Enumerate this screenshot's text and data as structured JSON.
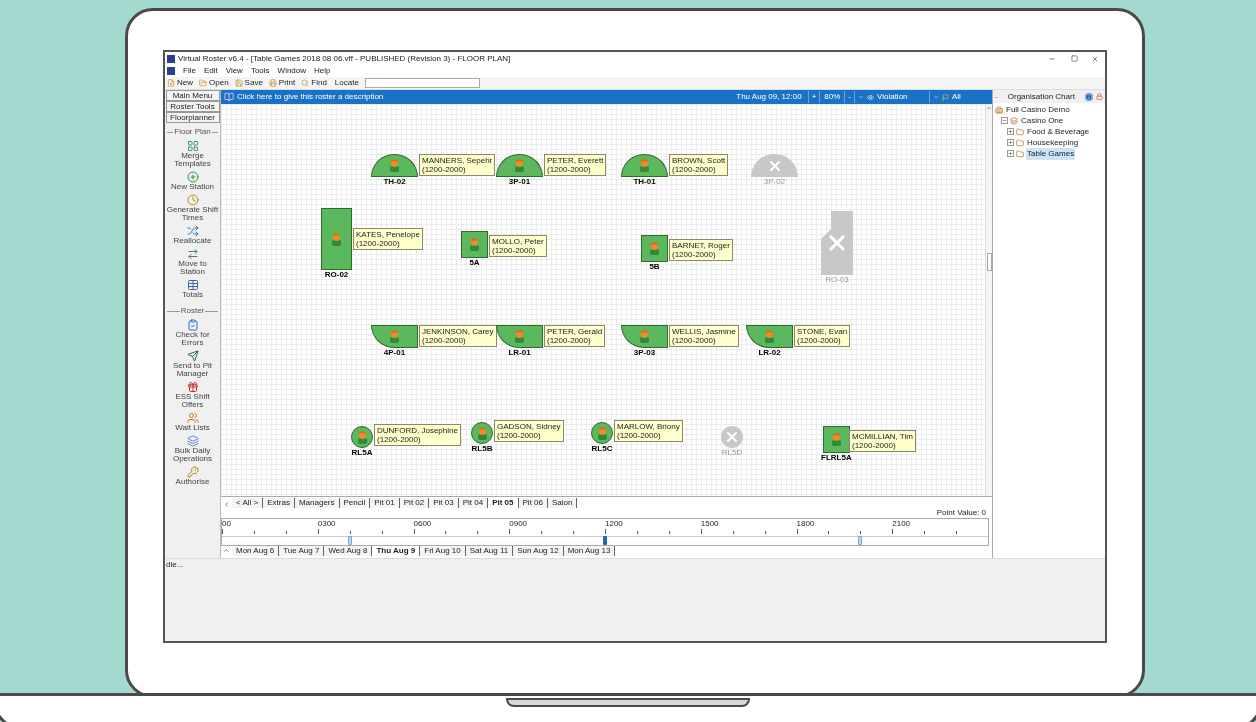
{
  "window": {
    "title": "Virtual Roster v6.4 - [Table Games 2018 08 06.vff - PUBLISHED (Revision 3) - FLOOR PLAN]"
  },
  "menu": [
    "File",
    "Edit",
    "View",
    "Tools",
    "Window",
    "Help"
  ],
  "toolbar": {
    "buttons": [
      "New",
      "Open",
      "Save",
      "Print",
      "Find"
    ],
    "locate_label": "Locate"
  },
  "sidebar": {
    "buttons": [
      "Main Menu",
      "Roster Tools",
      "Floorplanner"
    ],
    "sections": [
      {
        "title": "Floor Plan",
        "items": [
          "Merge Templates",
          "New Station",
          "Generate Shift Times",
          "Reallocate",
          "Move to Station",
          "Totals"
        ]
      },
      {
        "title": "Roster",
        "items": [
          "Check for Errors",
          "Send to Pit Manager",
          "ESS Shift Offers",
          "Wait Lists",
          "Bulk Daily Operations",
          "Authorise"
        ]
      }
    ]
  },
  "header_bar": {
    "description": "Click here to give this roster a description",
    "datetime": "Thu Aug 09, 12:00",
    "zoom_in": "+",
    "zoom": "80%",
    "zoom_out": "-",
    "filter": "Violation",
    "scope": "All"
  },
  "stations": [
    {
      "label": "TH-02",
      "kind": "dome",
      "active": true,
      "staff": {
        "name": "MANNERS, Sepehr",
        "hours": "(1200-2000)"
      }
    },
    {
      "label": "3P-01",
      "kind": "dome",
      "active": true,
      "staff": {
        "name": "PETER, Everett",
        "hours": "(1200-2000)"
      }
    },
    {
      "label": "TH-01",
      "kind": "dome",
      "active": true,
      "staff": {
        "name": "BROWN, Scott",
        "hours": "(1200-2000)"
      }
    },
    {
      "label": "3P-02",
      "kind": "dome",
      "active": false
    },
    {
      "label": "RO-02",
      "kind": "tall",
      "active": true,
      "staff": {
        "name": "KATES, Penelope",
        "hours": "(1200-2000)"
      }
    },
    {
      "label": "5A",
      "kind": "square",
      "active": true,
      "staff": {
        "name": "MOLLO, Peter",
        "hours": "(1200-2000)"
      }
    },
    {
      "label": "5B",
      "kind": "square",
      "active": true,
      "staff": {
        "name": "BARNET, Roger",
        "hours": "(1200-2000)"
      }
    },
    {
      "label": "RO-03",
      "kind": "polygon",
      "active": false
    },
    {
      "label": "4P-01",
      "kind": "bowl",
      "active": true,
      "staff": {
        "name": "JENKINSON, Carey",
        "hours": "(1200-2000)"
      }
    },
    {
      "label": "LR-01",
      "kind": "bowl",
      "active": true,
      "staff": {
        "name": "PETER, Gerald",
        "hours": "(1200-2000)"
      }
    },
    {
      "label": "3P-03",
      "kind": "bowl",
      "active": true,
      "staff": {
        "name": "WELLIS, Jasmine",
        "hours": "(1200-2000)"
      }
    },
    {
      "label": "LR-02",
      "kind": "bowl",
      "active": true,
      "staff": {
        "name": "STONE, Evan",
        "hours": "(1200-2000)"
      }
    },
    {
      "label": "RL5A",
      "kind": "circle",
      "active": true,
      "staff": {
        "name": "DUNFORD, Josephine",
        "hours": "(1200-2000)"
      }
    },
    {
      "label": "RL5B",
      "kind": "circle",
      "active": true,
      "staff": {
        "name": "GADSON, Sidney",
        "hours": "(1200-2000)"
      }
    },
    {
      "label": "RL5C",
      "kind": "circle",
      "active": true,
      "staff": {
        "name": "MARLOW, Briony",
        "hours": "(1200-2000)"
      }
    },
    {
      "label": "RL5D",
      "kind": "circle",
      "active": false
    },
    {
      "label": "FLRL5A",
      "kind": "square",
      "active": true,
      "staff": {
        "name": "MCMILLIAN, Tim",
        "hours": "(1200-2000)"
      }
    }
  ],
  "pit_tabs": [
    {
      "label": "< All >",
      "selected": false
    },
    {
      "label": "Extras",
      "selected": false
    },
    {
      "label": "Managers",
      "selected": false
    },
    {
      "label": "Pencil",
      "selected": false
    },
    {
      "label": "Pit 01",
      "selected": false
    },
    {
      "label": "Pit 02",
      "selected": false
    },
    {
      "label": "Pit 03",
      "selected": false
    },
    {
      "label": "Pit 04",
      "selected": false
    },
    {
      "label": "Pit 05",
      "selected": true
    },
    {
      "label": "Pit 06",
      "selected": false
    },
    {
      "label": "Salon",
      "selected": false
    }
  ],
  "point_value": "Point Value: 0",
  "timeline": {
    "ticks": [
      "00",
      "0300",
      "0600",
      "0900",
      "1200",
      "1500",
      "1800",
      "2100"
    ],
    "markers": [
      {
        "kind": "shift",
        "level": 0.1667
      },
      {
        "kind": "current",
        "level": 0.5
      },
      {
        "kind": "shift",
        "level": 0.8333
      }
    ]
  },
  "day_tabs": [
    {
      "label": "Mon Aug 6",
      "selected": false
    },
    {
      "label": "Tue Aug 7",
      "selected": false
    },
    {
      "label": "Wed Aug 8",
      "selected": false
    },
    {
      "label": "Thu Aug 9",
      "selected": true
    },
    {
      "label": "Fri Aug 10",
      "selected": false
    },
    {
      "label": "Sat Aug 11",
      "selected": false
    },
    {
      "label": "Sun Aug 12",
      "selected": false
    },
    {
      "label": "Mon Aug 13",
      "selected": false
    }
  ],
  "org_chart": {
    "title": "Organisation Chart",
    "collapse": "-",
    "tree": [
      {
        "label": "Full Casino Demo",
        "children": [
          {
            "label": "Casino One",
            "expanded": true,
            "selected": false,
            "children": [
              {
                "label": "Food & Beverage",
                "expanded": false,
                "selected": false
              },
              {
                "label": "Housekeeping",
                "expanded": false,
                "selected": false
              },
              {
                "label": "Table Games",
                "expanded": false,
                "selected": true
              }
            ]
          }
        ]
      }
    ]
  },
  "status_bar": {
    "text": "dle..."
  }
}
